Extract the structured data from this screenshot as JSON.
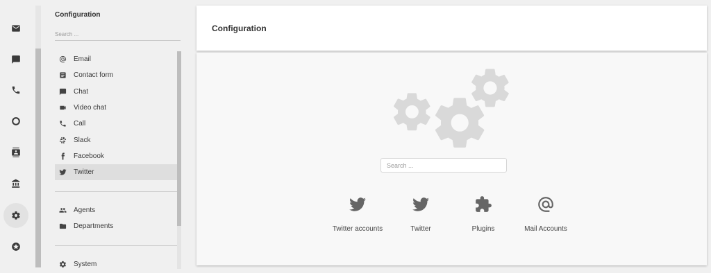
{
  "rail": {
    "items": [
      {
        "name": "mail-icon"
      },
      {
        "name": "chat-icon"
      },
      {
        "name": "phone-icon"
      },
      {
        "name": "circle-icon"
      },
      {
        "name": "contacts-icon"
      },
      {
        "name": "bank-icon"
      },
      {
        "name": "settings-icon",
        "active": true
      },
      {
        "name": "star-icon"
      }
    ]
  },
  "panel": {
    "title": "Configuration",
    "search_placeholder": "Search ...",
    "channels": [
      {
        "label": "Email",
        "icon": "at-icon"
      },
      {
        "label": "Contact form",
        "icon": "form-icon"
      },
      {
        "label": "Chat",
        "icon": "chat-icon"
      },
      {
        "label": "Video chat",
        "icon": "video-icon"
      },
      {
        "label": "Call",
        "icon": "phone-icon"
      },
      {
        "label": "Slack",
        "icon": "slack-icon"
      },
      {
        "label": "Facebook",
        "icon": "facebook-icon"
      },
      {
        "label": "Twitter",
        "icon": "twitter-icon",
        "active": true
      }
    ],
    "organization": [
      {
        "label": "Agents",
        "icon": "people-icon"
      },
      {
        "label": "Departments",
        "icon": "folder-icon"
      }
    ],
    "system": [
      {
        "label": "System",
        "icon": "gear-icon"
      }
    ]
  },
  "main": {
    "title": "Configuration",
    "search_placeholder": "Search ...",
    "tiles": [
      {
        "label": "Twitter accounts",
        "icon": "twitter-icon"
      },
      {
        "label": "Twitter",
        "icon": "twitter-icon"
      },
      {
        "label": "Plugins",
        "icon": "puzzle-icon"
      },
      {
        "label": "Mail Accounts",
        "icon": "at-icon"
      }
    ]
  },
  "colors": {
    "background": "#f0f0f0",
    "icon": "#3a3a3a",
    "gear_illustration": "#d9d9d9",
    "active_item": "#dedede"
  }
}
